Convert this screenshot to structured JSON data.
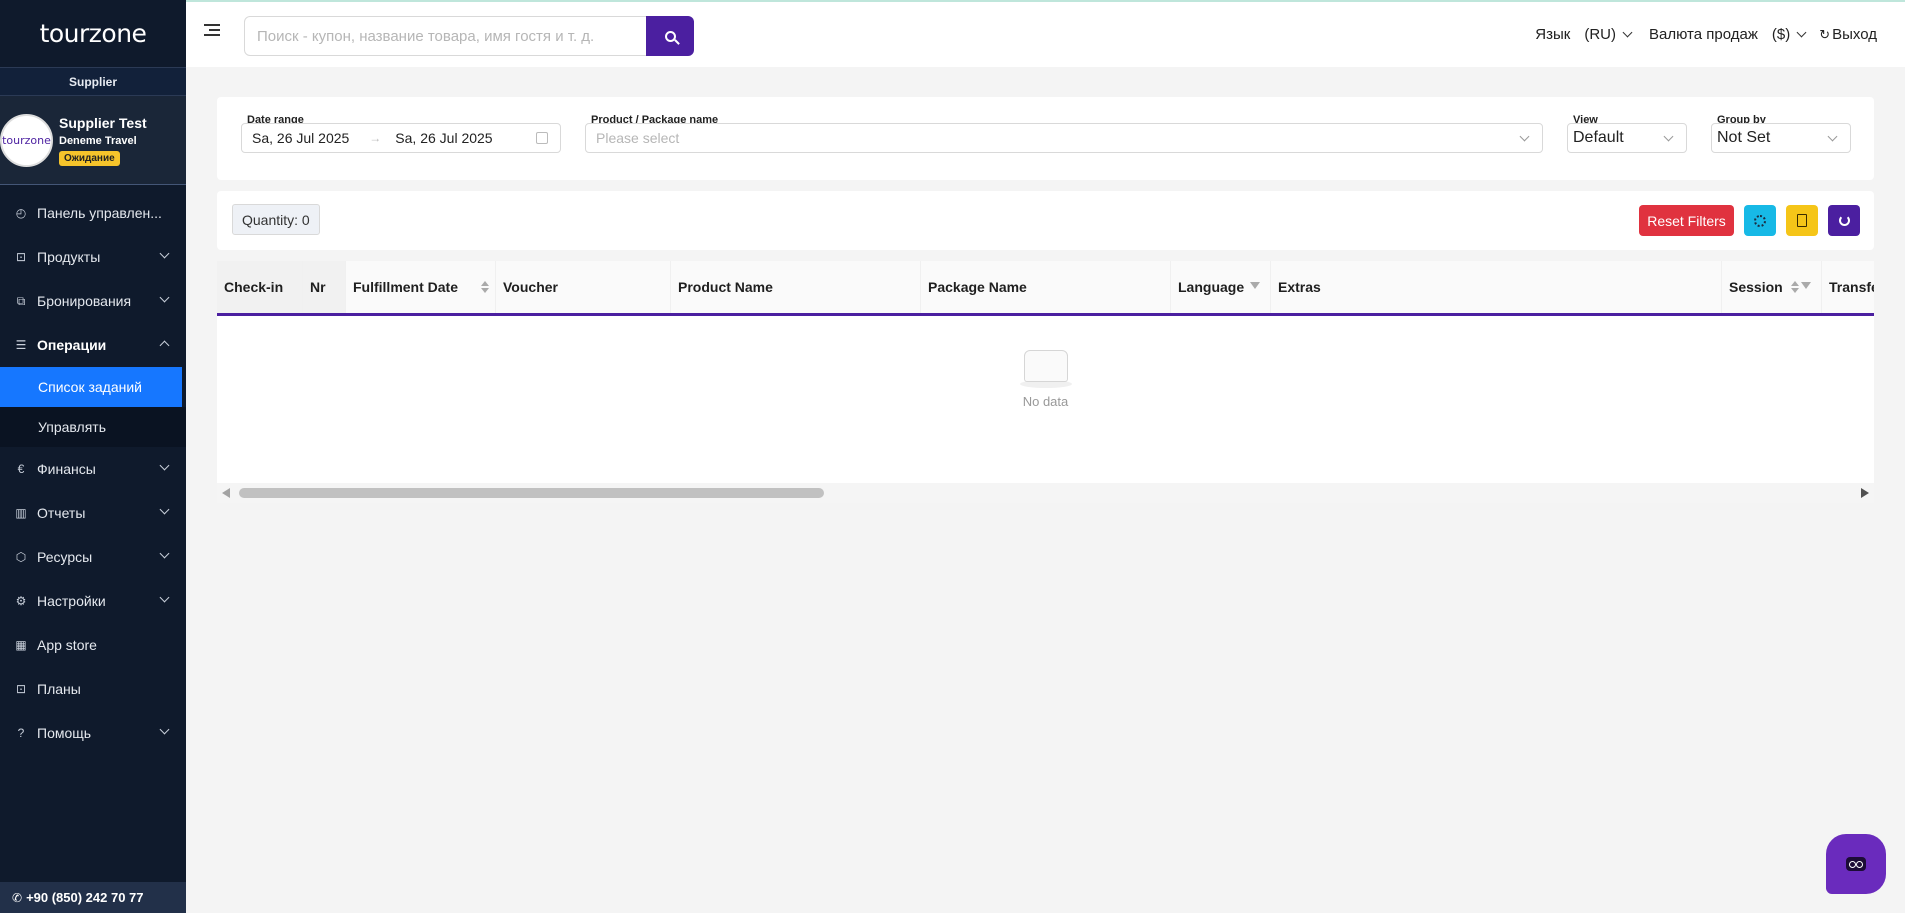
{
  "brand": {
    "logo_text": "tourzone",
    "role": "Supplier"
  },
  "supplier": {
    "avatar_text": "tourzone",
    "name": "Supplier Test",
    "company": "Deneme Travel",
    "status": "Ожидание"
  },
  "sidebar": {
    "items": [
      {
        "label": "Панель управлен...",
        "icon": "dashboard-icon"
      },
      {
        "label": "Продукты",
        "icon": "bag-icon"
      },
      {
        "label": "Бронирования",
        "icon": "ticket-icon"
      },
      {
        "label": "Операции",
        "icon": "list-icon"
      },
      {
        "label": "Финансы",
        "icon": "euro-icon"
      },
      {
        "label": "Отчеты",
        "icon": "bar-chart-icon"
      },
      {
        "label": "Ресурсы",
        "icon": "box-icon"
      },
      {
        "label": "Настройки",
        "icon": "gear-icon"
      },
      {
        "label": "App store",
        "icon": "apps-icon"
      },
      {
        "label": "Планы",
        "icon": "bag-icon"
      },
      {
        "label": "Помощь",
        "icon": "help-icon"
      }
    ],
    "sub_items": [
      {
        "label": "Список заданий",
        "active": true
      },
      {
        "label": "Управлять",
        "active": false
      }
    ],
    "phone": "+90 (850) 242 70 77"
  },
  "topbar": {
    "search_placeholder": "Поиск - купон, название товара, имя гостя и т. д.",
    "language_label": "Язык",
    "language_value": "(RU)",
    "currency_label": "Валюта продаж",
    "currency_value": "($)",
    "logout_label": "Выход"
  },
  "filters": {
    "date_range_label": "Date range",
    "date_from": "Sa, 26 Jul 2025",
    "date_to": "Sa, 26 Jul 2025",
    "product_label": "Product / Package name",
    "product_placeholder": "Please select",
    "view_label": "View",
    "view_value": "Default",
    "group_label": "Group by",
    "group_value": "Not Set"
  },
  "toolbar": {
    "quantity": "Quantity: 0",
    "reset_label": "Reset Filters"
  },
  "table": {
    "columns": [
      "Check-in",
      "Nr",
      "Fulfillment Date",
      "Voucher",
      "Product Name",
      "Package Name",
      "Language",
      "Extras",
      "Session",
      "Transfe"
    ],
    "empty_text": "No data"
  },
  "colors": {
    "sidebar_bg": "#0f1a2c",
    "accent_purple": "#4b1fa0",
    "active_blue": "#1677ff",
    "reset_red": "#e0323f",
    "badge_yellow": "#f6c42b"
  }
}
